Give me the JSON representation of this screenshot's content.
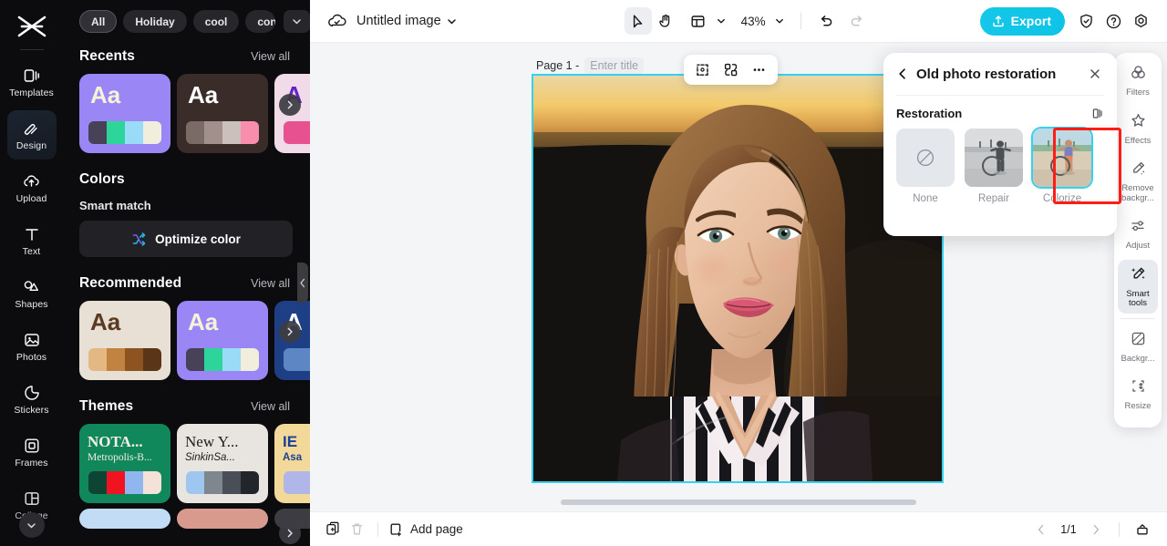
{
  "left_rail": {
    "logo": "capcut-logo",
    "items": [
      {
        "label": "Templates",
        "icon": "templates-icon",
        "active": false
      },
      {
        "label": "Design",
        "icon": "design-icon",
        "active": true
      },
      {
        "label": "Upload",
        "icon": "upload-icon",
        "active": false
      },
      {
        "label": "Text",
        "icon": "text-icon",
        "active": false
      },
      {
        "label": "Shapes",
        "icon": "shapes-icon",
        "active": false
      },
      {
        "label": "Photos",
        "icon": "photos-icon",
        "active": false
      },
      {
        "label": "Stickers",
        "icon": "stickers-icon",
        "active": false
      },
      {
        "label": "Frames",
        "icon": "frames-icon",
        "active": false
      },
      {
        "label": "Collage",
        "icon": "collage-icon",
        "active": false
      }
    ],
    "more_label": "chevron-down-icon"
  },
  "panel": {
    "chips": [
      {
        "label": "All",
        "selected": true
      },
      {
        "label": "Holiday",
        "selected": false
      },
      {
        "label": "cool",
        "selected": false
      },
      {
        "label": "concise",
        "selected": false
      }
    ],
    "sections": {
      "recents": {
        "title": "Recents",
        "view_all": "View all"
      },
      "colors": {
        "title": "Colors",
        "smart_match": "Smart match",
        "optimize": "Optimize color"
      },
      "recommended": {
        "title": "Recommended",
        "view_all": "View all"
      },
      "themes": {
        "title": "Themes",
        "view_all": "View all"
      }
    },
    "recents_cards": [
      {
        "aa": "Aa",
        "bg": "#9a86f5",
        "aa_color": "#f6f2d8",
        "swatches": [
          "#474257",
          "#2ed59a",
          "#9adcf7",
          "#f2eedd"
        ]
      },
      {
        "aa": "Aa",
        "bg": "#3a2c29",
        "aa_color": "#ffffff",
        "swatches": [
          "#7a6b66",
          "#a2908c",
          "#cbc0bc",
          "#f98dae"
        ]
      },
      {
        "aa": "A",
        "bg": "#f2dbe8",
        "aa_color": "#6323c8",
        "swatches": [
          "#e8518f",
          "#e8518f",
          "#e8518f",
          "#e8518f"
        ]
      }
    ],
    "recommended_cards": [
      {
        "aa": "Aa",
        "bg": "#e8e0d4",
        "aa_color": "#5a3a22",
        "swatches": [
          "#e3b882",
          "#c08440",
          "#8d5320",
          "#5b3518"
        ]
      },
      {
        "aa": "Aa",
        "bg": "#9a86f5",
        "aa_color": "#f6f2d8",
        "swatches": [
          "#474257",
          "#2ed59a",
          "#9adcf7",
          "#f2eedd"
        ]
      },
      {
        "aa": "A",
        "bg": "#1e3f86",
        "aa_color": "#ffffff",
        "swatches": [
          "#5d86c4",
          "#5d86c4",
          "#5d86c4",
          "#5d86c4"
        ]
      }
    ],
    "theme_cards": [
      {
        "t1": "NOTA...",
        "t2": "Metropolis-B...",
        "bg": "#11885c",
        "t1_color": "#f8efe4",
        "t2_color": "#f4ece2",
        "swatches": [
          "#0d4434",
          "#f01422",
          "#8fb6ef",
          "#f4e2d8"
        ]
      },
      {
        "t1": "New Y...",
        "t2": "SinkinSa...",
        "bg": "#e8e5e0",
        "t1_color": "#1d1d1f",
        "t2_color": "#1d1d1f",
        "swatches": [
          "#9fc6ef",
          "#7e868e",
          "#4a4f57",
          "#22252a"
        ]
      },
      {
        "t1": "IE",
        "t2": "Asa",
        "bg": "#f2d99a",
        "t1_color": "#1b3f96",
        "t2_color": "#1b3f96",
        "swatches": [
          "#b0b6e8",
          "#b0b6e8",
          "#b0b6e8",
          "#b0b6e8"
        ]
      }
    ]
  },
  "topbar": {
    "cloud_icon": "cloud-saved-icon",
    "doc_title": "Untitled image",
    "title_caret": "chevron-down-icon",
    "tools": [
      {
        "name": "select-tool",
        "icon": "cursor-icon",
        "active": true
      },
      {
        "name": "hand-tool",
        "icon": "hand-icon",
        "active": false
      },
      {
        "name": "layout-tool",
        "icon": "layout-icon",
        "active": false
      }
    ],
    "zoom": "43%",
    "zoom_caret": "chevron-down-icon",
    "undo": "undo-icon",
    "redo": "redo-icon",
    "export_label": "Export",
    "export_icon": "upload-arrow-icon",
    "right_icons": [
      "shield-check-icon",
      "help-circle-icon",
      "settings-gear-icon"
    ]
  },
  "canvas": {
    "page_label": "Page 1 -",
    "title_placeholder": "Enter title",
    "float_tools": [
      "crop-icon",
      "replace-icon",
      "more-horizontal-icon"
    ]
  },
  "flyout": {
    "back_icon": "chevron-left-icon",
    "title": "Old photo restoration",
    "close_icon": "close-icon",
    "section_label": "Restoration",
    "compare_icon": "compare-icon",
    "options": [
      {
        "label": "None",
        "selected": false,
        "kind": "none"
      },
      {
        "label": "Repair",
        "selected": false,
        "kind": "bw"
      },
      {
        "label": "Colorize",
        "selected": true,
        "kind": "color"
      }
    ]
  },
  "tool_rail": [
    {
      "label": "Filters",
      "icon": "filters-icon",
      "active": false
    },
    {
      "label": "Effects",
      "icon": "effects-icon",
      "active": false
    },
    {
      "label": "Remove backgr...",
      "icon": "remove-background-icon",
      "active": false
    },
    {
      "label": "Adjust",
      "icon": "adjust-icon",
      "active": false
    },
    {
      "label": "Smart tools",
      "icon": "smart-tools-icon",
      "active": true
    },
    {
      "label": "Backgr...",
      "icon": "background-icon",
      "active": false
    },
    {
      "label": "Resize",
      "icon": "resize-icon",
      "active": false
    }
  ],
  "bottombar": {
    "duplicate_icon": "duplicate-page-icon",
    "delete_icon": "trash-icon",
    "add_page_label": "Add page",
    "add_page_icon": "add-page-icon",
    "prev_icon": "chevron-left-icon",
    "page_indicator": "1/1",
    "next_icon": "chevron-right-icon",
    "expand_icon": "expand-panel-icon"
  },
  "colors": {
    "accent": "#15c7e8",
    "selection": "#35d2f0",
    "highlight_box": "#ff1d15",
    "panel_bg": "#0c0c0e",
    "stage_bg": "#f4f5f7"
  }
}
